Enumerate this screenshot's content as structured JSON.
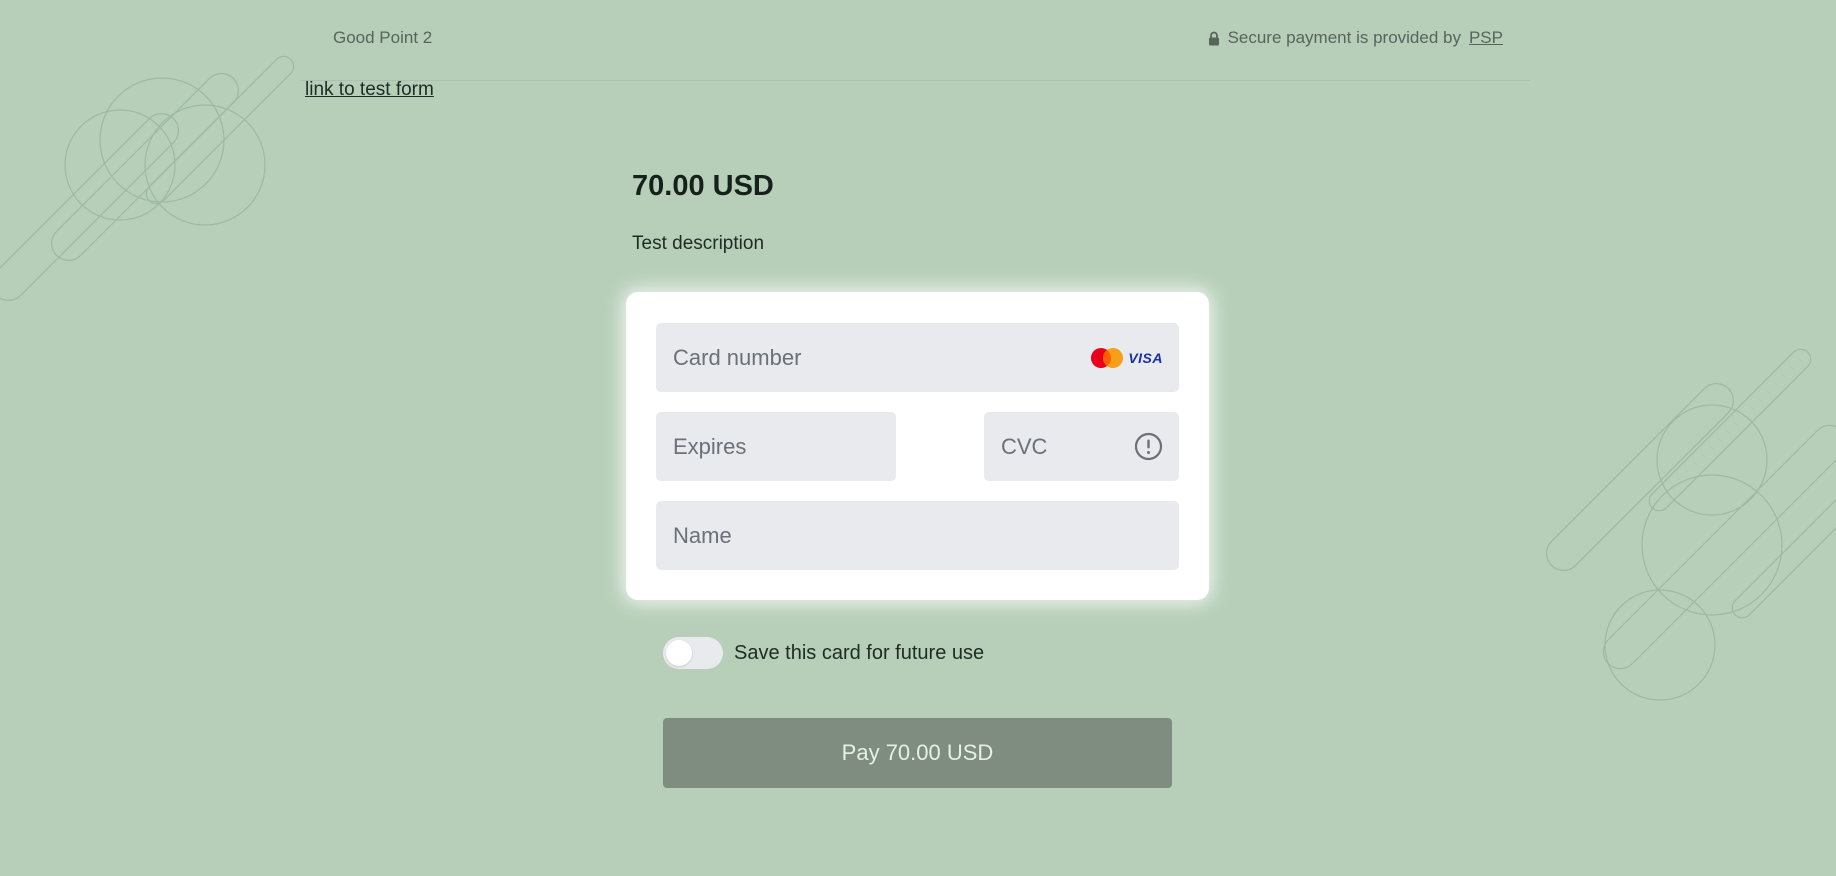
{
  "header": {
    "merchant_name": "Good Point 2",
    "secure_text": "Secure payment is provided by",
    "secure_link": "PSP",
    "lock_icon": "lock-icon"
  },
  "test_link": "link to test form",
  "order": {
    "amount": "70.00 USD",
    "description": "Test description"
  },
  "form": {
    "card_number_placeholder": "Card number",
    "expires_placeholder": "Expires",
    "cvc_placeholder": "CVC",
    "name_placeholder": "Name",
    "visa_label": "VISA",
    "brand_icons": [
      "mastercard-icon",
      "visa-icon"
    ],
    "cvc_info_icon": "info-icon"
  },
  "save_card": {
    "label": "Save this card for future use",
    "enabled": false
  },
  "pay_button": {
    "label": "Pay 70.00 USD"
  },
  "colors": {
    "background": "#b7cfb9",
    "pay_button": "#7f8c80",
    "field_background": "#e9eaee",
    "visa_blue": "#1a2fa8"
  }
}
